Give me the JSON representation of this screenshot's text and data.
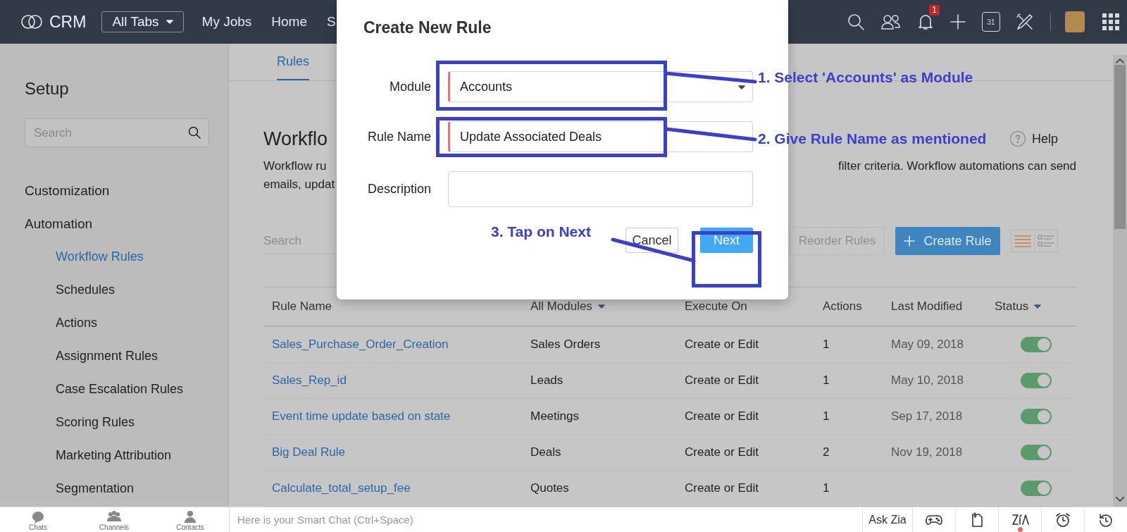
{
  "top_bar": {
    "logo": "CRM",
    "all_tabs": "All Tabs",
    "nav": [
      "My Jobs",
      "Home",
      "S"
    ],
    "notification_count": "1",
    "calendar_day": "31"
  },
  "sidebar": {
    "title": "Setup",
    "search": {
      "placeholder": "Search"
    },
    "items": [
      {
        "label": "Customization",
        "selected": false
      },
      {
        "label": "Automation",
        "selected": false,
        "children": [
          {
            "label": "Workflow Rules",
            "selected": true
          },
          {
            "label": "Schedules",
            "selected": false
          },
          {
            "label": "Actions",
            "selected": false
          },
          {
            "label": "Assignment Rules",
            "selected": false
          },
          {
            "label": "Case Escalation Rules",
            "selected": false
          },
          {
            "label": "Scoring Rules",
            "selected": false
          },
          {
            "label": "Marketing Attribution",
            "selected": false
          },
          {
            "label": "Segmentation",
            "selected": false
          }
        ]
      }
    ]
  },
  "main": {
    "tabs": [
      {
        "label": "Rules",
        "selected": true
      }
    ],
    "heading": "Workflo",
    "help": "Help",
    "description_left": [
      "Workflow ru",
      "emails, updat"
    ],
    "description_right": "filter criteria. Workflow automations can send",
    "search": {
      "placeholder": "Search"
    },
    "reorder_button": "Reorder Rules",
    "create_button": "Create Rule",
    "view_toggle": [
      {
        "kind": "list",
        "selected": true
      },
      {
        "kind": "detail",
        "selected": false
      }
    ],
    "table": {
      "columns": [
        {
          "label": "Rule Name",
          "has_menu": false
        },
        {
          "label": "All Modules",
          "has_menu": true
        },
        {
          "label": "Execute On",
          "has_menu": false
        },
        {
          "label": "Actions",
          "has_menu": false
        },
        {
          "label": "Last Modified",
          "has_menu": false
        },
        {
          "label": "Status",
          "has_menu": true
        }
      ],
      "rows": [
        {
          "rule_name": "Sales_Purchase_Order_Creation",
          "module": "Sales Orders",
          "execute_on": "Create or Edit",
          "actions": "1",
          "last_modified": "May 09, 2018",
          "status_on": true
        },
        {
          "rule_name": "Sales_Rep_id",
          "module": "Leads",
          "execute_on": "Create or Edit",
          "actions": "1",
          "last_modified": "May 10, 2018",
          "status_on": true
        },
        {
          "rule_name": "Event time update based on state",
          "module": "Meetings",
          "execute_on": "Create or Edit",
          "actions": "1",
          "last_modified": "Sep 17, 2018",
          "status_on": true
        },
        {
          "rule_name": "Big Deal Rule",
          "module": "Deals",
          "execute_on": "Create or Edit",
          "actions": "2",
          "last_modified": "Nov 19, 2018",
          "status_on": true
        },
        {
          "rule_name": "Calculate_total_setup_fee",
          "module": "Quotes",
          "execute_on": "Create or Edit",
          "actions": "1",
          "status_on": true
        }
      ]
    }
  },
  "modal": {
    "title": "Create New Rule",
    "fields": [
      {
        "label": "Module",
        "kind": "select",
        "value": "Accounts",
        "required": true
      },
      {
        "label": "Rule Name",
        "kind": "text",
        "value": "Update Associated Deals",
        "required": true
      },
      {
        "label": "Description",
        "kind": "textarea",
        "required": false
      }
    ],
    "buttons": [
      {
        "label": "Cancel",
        "kind": "secondary"
      },
      {
        "label": "Next",
        "kind": "primary"
      }
    ]
  },
  "annotations": [
    {
      "text": "1. Select 'Accounts' as Module"
    },
    {
      "text": "2. Give Rule Name as mentioned"
    },
    {
      "text": "3. Tap on Next"
    }
  ],
  "bottom_bar": {
    "tabs": [
      {
        "label": "Chats",
        "kind": "chats"
      },
      {
        "label": "Channels",
        "kind": "channels"
      },
      {
        "label": "Contacts",
        "kind": "contacts"
      }
    ],
    "chat_placeholder": "Here is your Smart Chat (Ctrl+Space)",
    "ask_zia": "Ask Zia",
    "tools": [
      {
        "kind": "gamepad",
        "alert": false
      },
      {
        "kind": "notes",
        "alert": false
      },
      {
        "kind": "zia",
        "alert": true
      },
      {
        "kind": "alarm",
        "alert": false
      },
      {
        "kind": "history",
        "alert": false
      }
    ]
  }
}
